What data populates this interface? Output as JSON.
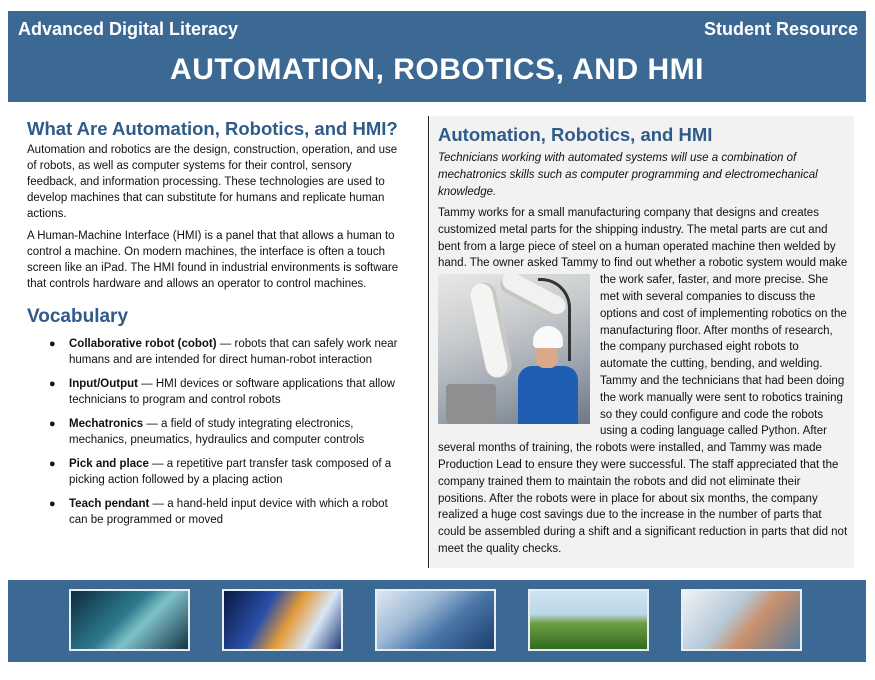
{
  "header": {
    "left": "Advanced Digital Literacy",
    "right": "Student Resource",
    "title": "AUTOMATION, ROBOTICS, AND HMI"
  },
  "left": {
    "heading": "What Are Automation, Robotics, and HMI?",
    "p1": "Automation and robotics are the design, construction, operation, and use of robots, as well as computer systems for their control, sensory feedback, and information processing. These technologies are used to develop machines that can substitute for humans and replicate human actions.",
    "p2": "A Human-Machine Interface (HMI) is a panel that that allows a human to control a machine. On modern machines, the interface is often a touch screen like an iPad. The HMI found in industrial environments is software that controls hardware and allows an operator to control machines.",
    "vocab_heading": "Vocabulary",
    "vocab": [
      {
        "term": "Collaborative robot (cobot)",
        "def": " — robots that can safely work near humans and are intended for direct human-robot interaction"
      },
      {
        "term": "Input/Output",
        "def": " — HMI devices or software applications that allow technicians to program and control robots"
      },
      {
        "term": "Mechatronics",
        "def": " — a field of study integrating electronics, mechanics, pneumatics, hydraulics and computer controls"
      },
      {
        "term": "Pick and place",
        "def": " — a repetitive part transfer task composed of a picking action followed by a placing action"
      },
      {
        "term": "Teach pendant",
        "def": " — a hand-held input device with which a robot can be programmed or moved"
      }
    ]
  },
  "right": {
    "heading": "Automation, Robotics, and HMI",
    "intro": "Technicians working with automated systems will use a combination of mechatronics skills such as computer programming and electromechanical knowledge.",
    "story_a": "Tammy works for a small manufacturing company that designs and creates customized metal parts for the shipping industry. The metal parts are cut and bent from a large piece of steel on a human operated machine then welded by hand. The owner asked Tammy to find out whether a robotic system would",
    "story_b": "make the work safer, faster, and more precise. She met with several companies to discuss the options and cost of implementing robotics on the manufacturing floor. After months of research, the company purchased eight robots to automate the cutting, bending, and welding. Tammy and the technicians that had been doing the work manually were sent to robotics training so they could configure and code the robots using a coding language called Python. After several months of training, the robots were installed, and Tammy was made Production Lead to ensure they were successful. The staff appreciated that the company trained them to maintain the robots and did not eliminate their positions. After the robots were in place for about six months, the company realized a huge cost savings due to the increase in the number of parts that could be assembled during a shift and a significant reduction in parts that did not meet the quality checks."
  },
  "icons": {
    "photo": "robot-arm-technician-photo",
    "thumbs": [
      "students-lab-thumbnail",
      "smart-city-thumbnail",
      "robot-hand-thumbnail",
      "drones-farm-thumbnail",
      "scientist-thumbnail"
    ]
  },
  "colors": {
    "banner": "#3b6994",
    "heading": "#2e5b8a",
    "panel": "#f2f2f2"
  }
}
